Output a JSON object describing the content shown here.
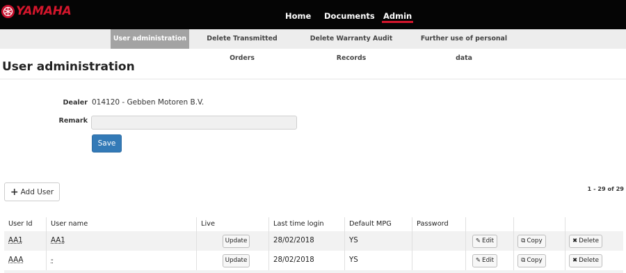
{
  "brand": {
    "name": "YAMAHA",
    "color": "#d4162c"
  },
  "nav": {
    "items": [
      {
        "label": "Home",
        "active": false
      },
      {
        "label": "Documents",
        "active": false
      },
      {
        "label": "Admin",
        "active": true
      }
    ]
  },
  "subnav": {
    "items": [
      {
        "label": "User administration",
        "active": true
      },
      {
        "label": "Delete Transmitted Orders",
        "active": false
      },
      {
        "label": "Delete Warranty Audit Records",
        "active": false
      },
      {
        "label": "Further use of personal data",
        "active": false
      }
    ]
  },
  "page": {
    "title": "User administration"
  },
  "form": {
    "dealer_label": "Dealer",
    "dealer_value": "014120  - Gebben Motoren B.V.",
    "remark_label": "Remark",
    "remark_value": "",
    "save_label": "Save"
  },
  "toolbar": {
    "add_user_label": "Add User",
    "pager_text": "1 - 29 of 29"
  },
  "table": {
    "headers": [
      "User Id",
      "User name",
      "Live",
      "Last time login",
      "Default MPG",
      "Password",
      "",
      "",
      ""
    ],
    "rows": [
      {
        "user_id": "AA1",
        "user_name": "AA1",
        "live_button": "Update",
        "last_login": "28/02/2018",
        "default_mpg": "YS",
        "password": "",
        "edit": "Edit",
        "copy": "Copy",
        "delete": "Delete"
      },
      {
        "user_id": "AAA",
        "user_name": "-",
        "live_button": "Update",
        "last_login": "28/02/2018",
        "default_mpg": "YS",
        "password": "",
        "edit": "Edit",
        "copy": "Copy",
        "delete": "Delete"
      }
    ]
  },
  "icons": {
    "add": "plus-icon",
    "edit": "edit-icon",
    "copy": "copy-icon",
    "delete": "close-icon"
  },
  "colors": {
    "primary_button": "#337ab7",
    "nav_bg": "#050505",
    "active_underline": "#d4162c",
    "subnav_active": "#a3a3a3"
  }
}
